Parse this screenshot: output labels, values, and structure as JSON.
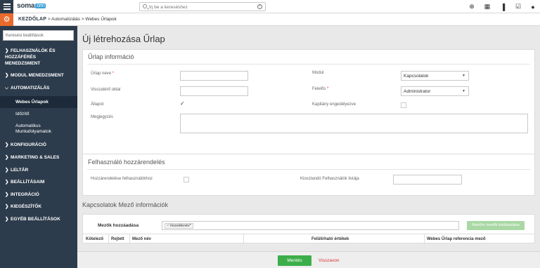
{
  "topbar": {
    "logo_main": "soma",
    "logo_badge": "crm",
    "search_placeholder": "Írj be a kereséshez",
    "icons": [
      "plus-circle-icon",
      "calendar-icon",
      "bar-chart-icon",
      "checkbox-icon",
      "user-icon"
    ]
  },
  "breadcrumb": {
    "home": "KEZDŐLAP",
    "sep": ">",
    "level1": "Automatizálás",
    "level2": "Webes Űrlapok"
  },
  "sidebar": {
    "search_placeholder": "Keresési beállítások",
    "items": [
      {
        "label": "FELHASZNÁLÓK ÉS"
      },
      {
        "label": "HOZZÁFÉRÉS"
      },
      {
        "label": "MENEDZSMENT"
      },
      {
        "label": "MODUL MENEDZSMENT"
      },
      {
        "label": "AUTOMATIZÁLÁS"
      },
      {
        "label": "KONFIGURÁCIÓ"
      },
      {
        "label": "MARKETING & SALES"
      },
      {
        "label": "LELTÁR"
      },
      {
        "label": "BEÁLLÍTÁSAIM"
      },
      {
        "label": "INTEGRÁCIÓ"
      },
      {
        "label": "KIEGÉSZÍTŐK"
      },
      {
        "label": "EGYÉB BEÁLLÍTÁSOK"
      }
    ],
    "subitems": [
      {
        "label": "Webes Űrlapok"
      },
      {
        "label": "Időzítő"
      },
      {
        "label": "Automatikus"
      },
      {
        "label": "Munkafolyamatok"
      }
    ]
  },
  "page": {
    "title": "Új létrehozása Űrlap"
  },
  "form_info": {
    "title": "Űrlap információ",
    "name_label": "Űrlap neve",
    "required_mark": "*",
    "return_label": "Visszatérő oldal",
    "status_label": "Állapot",
    "desc_label": "Megjegyzés",
    "module_label": "Modul",
    "module_value": "Kapcsolatok",
    "owner_label": "Felelős",
    "owner_value": "Administrator",
    "captcha_label": "Kapitány engedélyezve",
    "status_checked": "✓"
  },
  "user_assign": {
    "title": "Felhasználó hozzárendelés",
    "assign_label": "Hozzárendelése felhasználókhoz",
    "list_label": "Kiosztandó Felhasználók listája"
  },
  "fields": {
    "title": "Kapcsolatok Mező információk",
    "add_label": "Mezők hozzáadása",
    "tag_x": "×",
    "tag_value": "Vezetéknév*",
    "add_button": "Mezőre mezők kiválasztása",
    "col_required": "Kötelező",
    "col_hidden": "Rejtett",
    "col_field": "Mező név",
    "col_override": "Felülírható értékek",
    "col_ref": "Webes Űrlap referencia mező"
  },
  "footer": {
    "save": "Mentés",
    "back": "Visszavon"
  },
  "colors": {
    "sidebar_bg": "#2d3c4c",
    "accent_orange": "#e86a2d",
    "save_green": "#3cae49",
    "cancel_red": "#dd3333"
  }
}
